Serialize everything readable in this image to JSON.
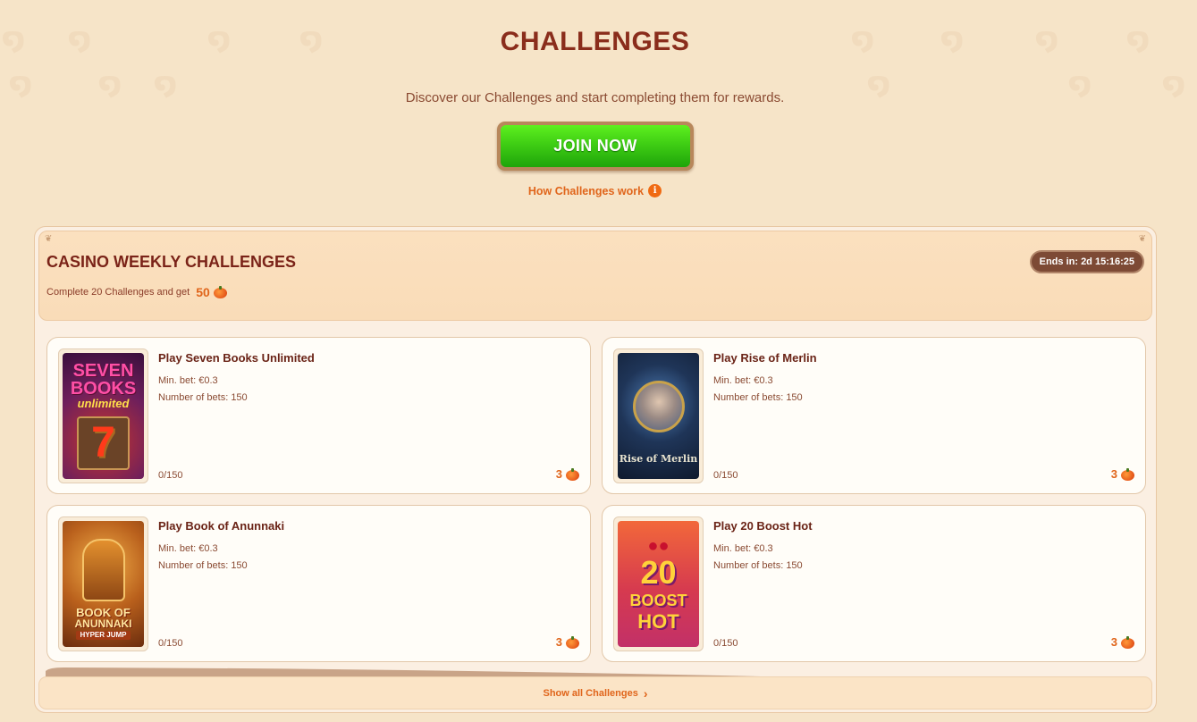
{
  "header": {
    "title": "CHALLENGES",
    "subtitle": "Discover our Challenges and start completing them for rewards.",
    "join_label": "JOIN NOW",
    "how_label": "How Challenges work",
    "info_glyph": "i"
  },
  "panel": {
    "title": "CASINO WEEKLY CHALLENGES",
    "subtitle": "Complete 20 Challenges and get",
    "reward": "50",
    "ends": "Ends in: 2d 15:16:25",
    "show_all": "Show all Challenges",
    "show_all_glyph": "›"
  },
  "cards": [
    {
      "name": "Play Seven Books Unlimited",
      "min_bet": "Min. bet: €0.3",
      "bets": "Number of bets: 150",
      "progress": "0/150",
      "reward": "3",
      "art": {
        "line1": "SEVEN",
        "line2": "BOOKS",
        "line3": "unlimited"
      }
    },
    {
      "name": "Play Rise of Merlin",
      "min_bet": "Min. bet: €0.3",
      "bets": "Number of bets: 150",
      "progress": "0/150",
      "reward": "3",
      "art": {
        "line1": "Rise of Merlin"
      }
    },
    {
      "name": "Play Book of Anunnaki",
      "min_bet": "Min. bet: €0.3",
      "bets": "Number of bets: 150",
      "progress": "0/150",
      "reward": "3",
      "art": {
        "line1": "BOOK OF",
        "line2": "ANUNNAKI",
        "line3": "HYPER JUMP"
      }
    },
    {
      "name": "Play 20 Boost Hot",
      "min_bet": "Min. bet: €0.3",
      "bets": "Number of bets: 150",
      "progress": "0/150",
      "reward": "3",
      "art": {
        "line1": "20",
        "line2": "BOOST",
        "line3": "HOT"
      }
    }
  ],
  "icons": {
    "reward_icon": "pumpkin-icon",
    "info_icon": "info-icon",
    "chevron": "chevron-right-icon"
  },
  "colors": {
    "background": "#f6e4c8",
    "title": "#8a2d1c",
    "accent": "#e0651b",
    "join_green": "#3fce14"
  }
}
